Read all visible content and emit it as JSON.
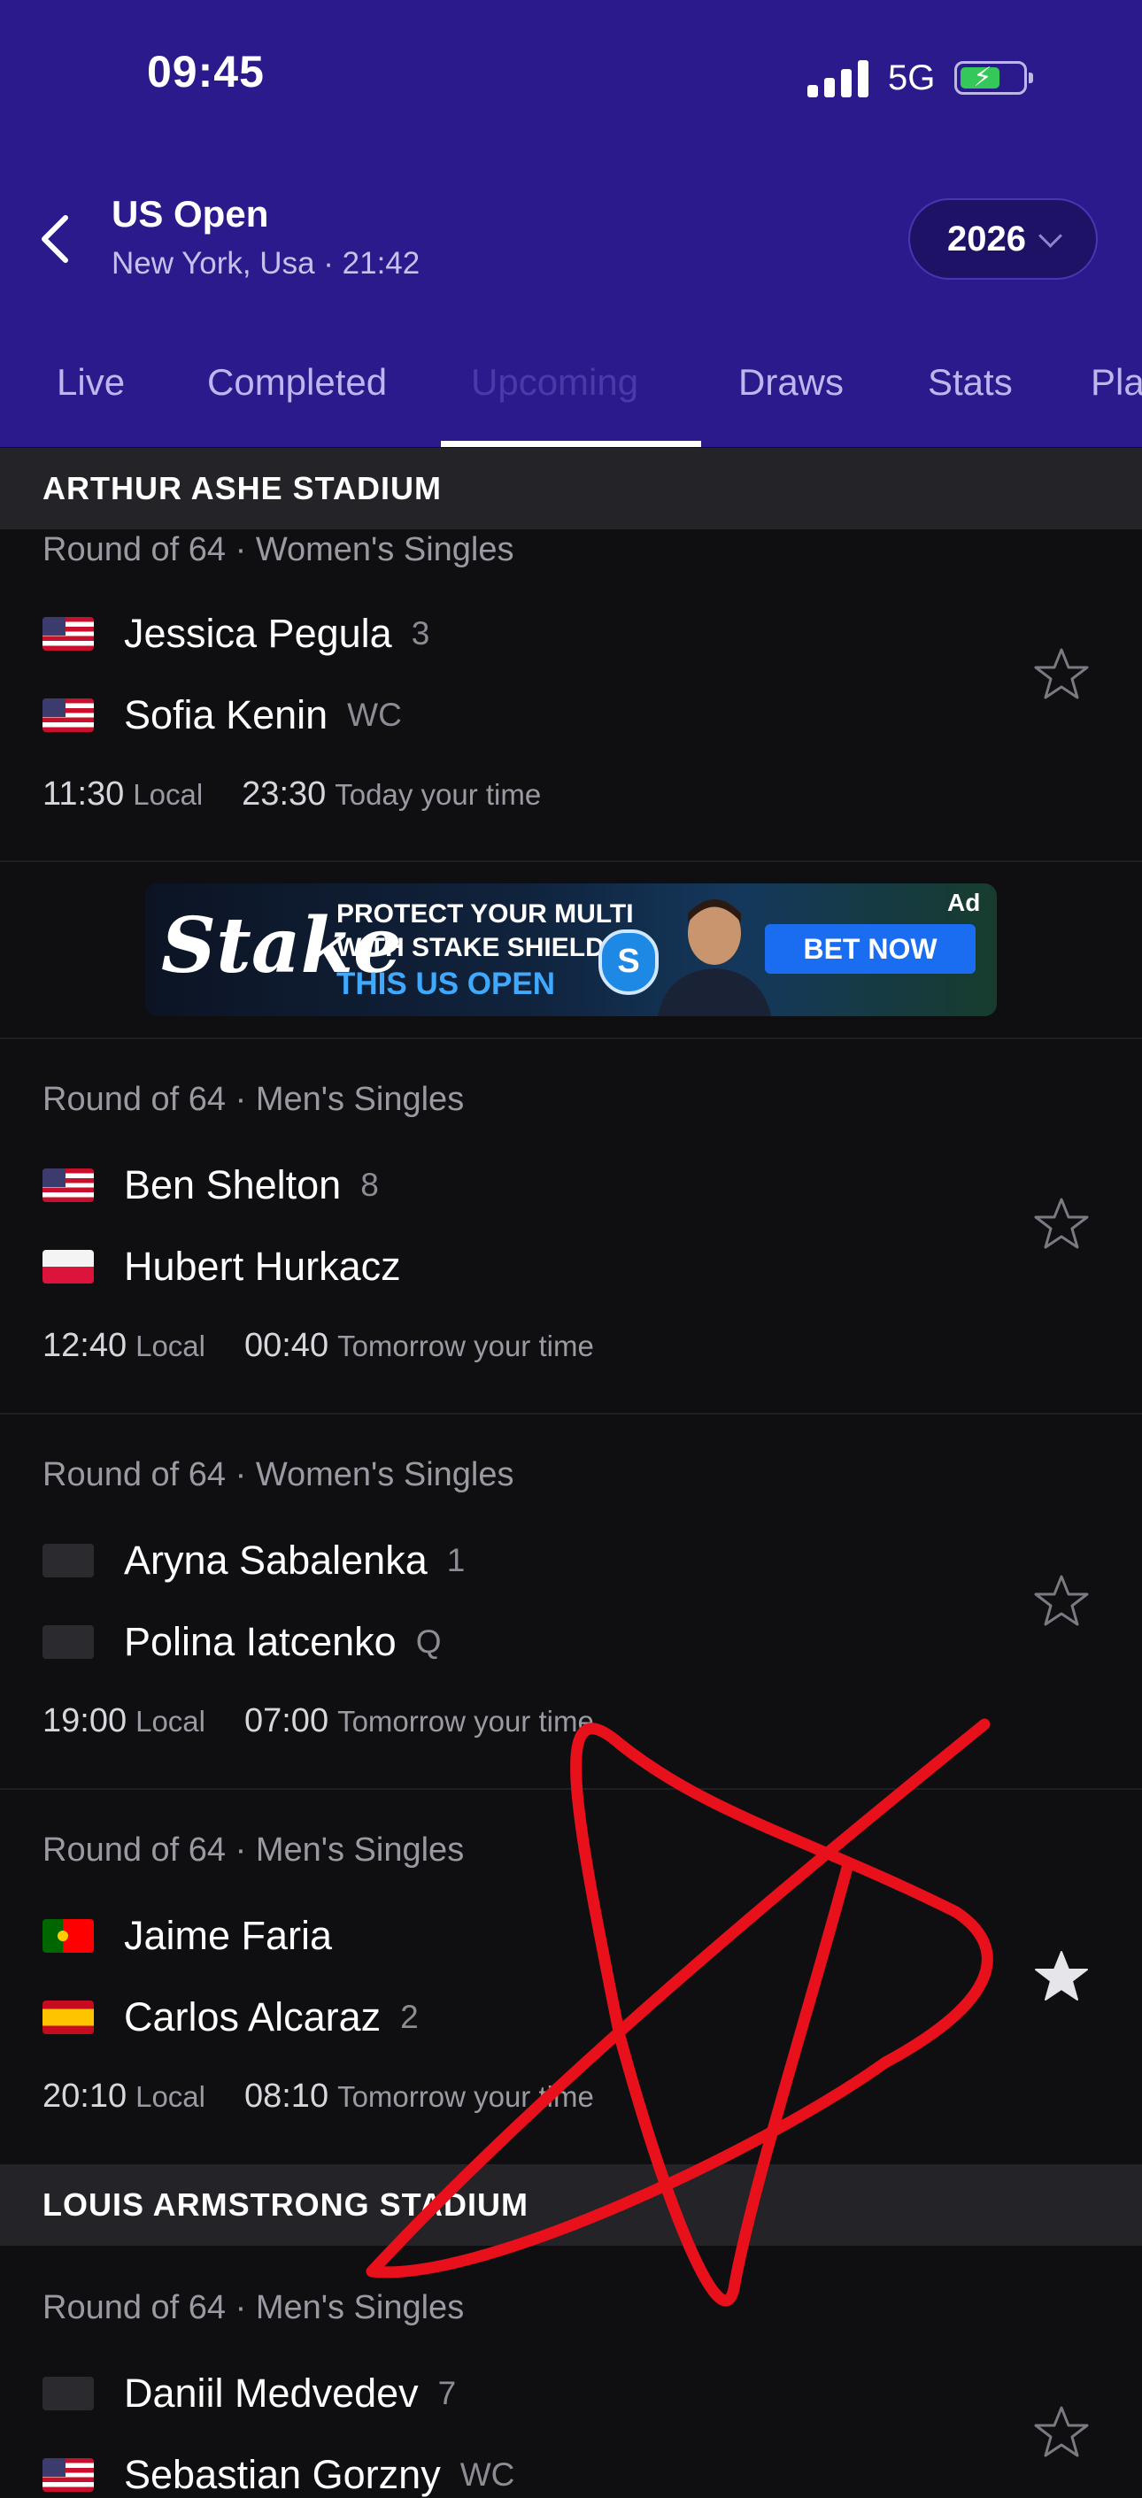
{
  "status_bar": {
    "time": "09:45",
    "network": "5G"
  },
  "header": {
    "title": "US Open",
    "subtitle": "New York, Usa · 21:42",
    "year": "2026",
    "tabs": [
      {
        "label": "Live"
      },
      {
        "label": "Completed"
      },
      {
        "label": "Upcoming"
      },
      {
        "label": "Draws"
      },
      {
        "label": "Stats"
      },
      {
        "label": "Pla"
      }
    ],
    "active_tab": "Upcoming"
  },
  "sections": [
    {
      "name": "ARTHUR ASHE STADIUM"
    },
    {
      "name": "LOUIS ARMSTRONG STADIUM"
    }
  ],
  "ad": {
    "brand": "Stake",
    "line1": "PROTECT YOUR MULTI",
    "line2": "WITH STAKE SHIELD",
    "line3": "THIS US OPEN",
    "cta": "BET NOW",
    "label": "Ad"
  },
  "matches": [
    {
      "round": "Round of 64  ·  Women's Singles",
      "p1": {
        "name": "Jessica Pegula",
        "seed": "3",
        "flag": "us"
      },
      "p2": {
        "name": "Sofia Kenin",
        "seed": "WC",
        "flag": "us"
      },
      "local_time": "11:30",
      "local_label": "Local",
      "your_time": "23:30",
      "your_label": "Today your time",
      "favorited": false
    },
    {
      "round": "Round of 64  ·  Men's Singles",
      "p1": {
        "name": "Ben Shelton",
        "seed": "8",
        "flag": "us"
      },
      "p2": {
        "name": "Hubert Hurkacz",
        "seed": "",
        "flag": "pl"
      },
      "local_time": "12:40",
      "local_label": "Local",
      "your_time": "00:40",
      "your_label": "Tomorrow your time",
      "favorited": false
    },
    {
      "round": "Round of 64  ·  Women's Singles",
      "p1": {
        "name": "Aryna Sabalenka",
        "seed": "1",
        "flag": "none"
      },
      "p2": {
        "name": "Polina Iatcenko",
        "seed": "Q",
        "flag": "none"
      },
      "local_time": "19:00",
      "local_label": "Local",
      "your_time": "07:00",
      "your_label": "Tomorrow your time",
      "favorited": false
    },
    {
      "round": "Round of 64  ·  Men's Singles",
      "p1": {
        "name": "Jaime Faria",
        "seed": "",
        "flag": "pt"
      },
      "p2": {
        "name": "Carlos Alcaraz",
        "seed": "2",
        "flag": "es"
      },
      "local_time": "20:10",
      "local_label": "Local",
      "your_time": "08:10",
      "your_label": "Tomorrow your time",
      "favorited": true
    },
    {
      "round": "Round of 64  ·  Men's Singles",
      "p1": {
        "name": "Daniil Medvedev",
        "seed": "7",
        "flag": "none"
      },
      "p2": {
        "name": "Sebastian Gorzny",
        "seed": "WC",
        "flag": "us"
      },
      "favorited": false
    }
  ],
  "colors": {
    "header_bg": "#2b1a8c",
    "page_bg": "#0f0f12",
    "section_bg": "#232328",
    "annotation_red": "#e8101a"
  }
}
